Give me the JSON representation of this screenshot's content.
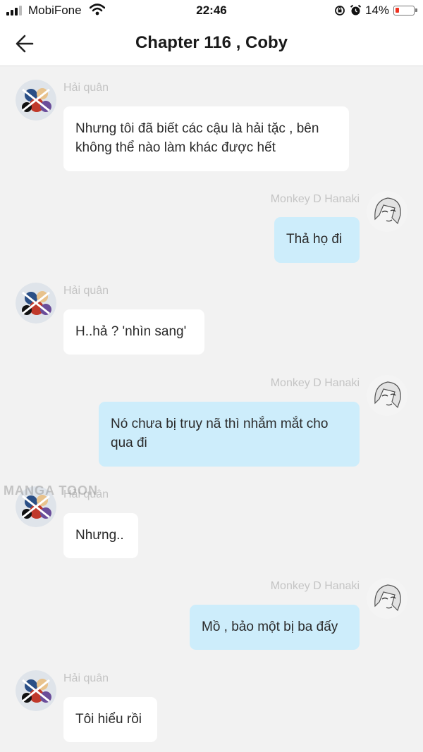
{
  "status_bar": {
    "carrier": "MobiFone",
    "time": "22:46",
    "battery_percent": "14%",
    "battery_level": 0.14,
    "icons": [
      "signal-icon",
      "wifi-icon",
      "rotation-lock-icon",
      "alarm-icon",
      "battery-icon"
    ]
  },
  "header": {
    "title": "Chapter 116 , Coby",
    "back_icon": "back-arrow-icon"
  },
  "messages": [
    {
      "side": "left",
      "sender": "Hải quân",
      "text": "Nhưng tôi đã biết các cậu là hải tặc , bên không thể nào làm khác được hết"
    },
    {
      "side": "right",
      "sender": "Monkey D Hanaki",
      "text": "Thả họ đi"
    },
    {
      "side": "left",
      "sender": "Hải quân",
      "text": "H..hả ? 'nhìn sang'"
    },
    {
      "side": "right",
      "sender": "Monkey D Hanaki",
      "text": "Nó chưa bị truy nã thì nhắm mắt cho qua đi"
    },
    {
      "side": "left",
      "sender": "Hải quân",
      "text": "Nhưng.."
    },
    {
      "side": "right",
      "sender": "Monkey D Hanaki",
      "text": "Mồ , bảo một bị ba đấy"
    },
    {
      "side": "left",
      "sender": "Hải quân",
      "text": "Tôi hiểu rồi"
    }
  ],
  "watermark": "MANGA TOON",
  "colors": {
    "background": "#f2f2f2",
    "left_bubble": "#ffffff",
    "right_bubble": "#cdedfb",
    "sender_name": "#c4c4c4",
    "battery_low": "#ee3322"
  }
}
